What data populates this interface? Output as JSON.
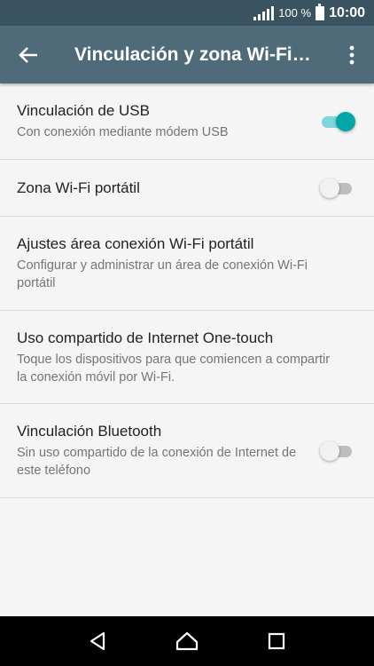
{
  "status_bar": {
    "battery_percent": "100 %",
    "time": "10:00"
  },
  "app_bar": {
    "title": "Vinculación y zona Wi-Fi…",
    "back_icon": "arrow-left-icon",
    "more_icon": "more-vert-icon"
  },
  "items": [
    {
      "title": "Vinculación de USB",
      "subtitle": "Con conexión mediante módem USB",
      "toggle": "on"
    },
    {
      "title": "Zona Wi-Fi portátil",
      "subtitle": "",
      "toggle": "off"
    },
    {
      "title": "Ajustes área conexión Wi-Fi portátil",
      "subtitle": "Configurar y administrar un área de conexión Wi-Fi portátil",
      "toggle": null
    },
    {
      "title": "Uso compartido de Internet One-touch",
      "subtitle": "Toque los dispositivos para que comiencen a compartir la conexión móvil por Wi-Fi.",
      "toggle": null
    },
    {
      "title": "Vinculación Bluetooth",
      "subtitle": "Sin uso compartido de la conexión de Internet de este teléfono",
      "toggle": "off"
    }
  ],
  "colors": {
    "status_bar": "#3a5361",
    "app_bar": "#4f6a79",
    "accent": "#00a6a9",
    "background": "#f5f5f5"
  }
}
